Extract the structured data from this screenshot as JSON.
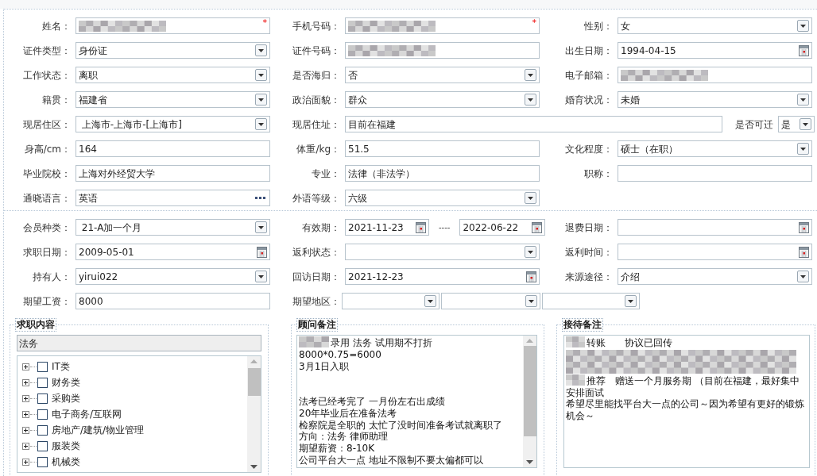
{
  "sections": [
    {
      "rows": [
        [
          {
            "label": "姓名：",
            "kind": "text",
            "redacted": true,
            "required_mark": "*"
          },
          {
            "label": "手机号码：",
            "kind": "text",
            "redacted": true,
            "required_mark": "*"
          },
          {
            "label": "性别：",
            "kind": "select",
            "value": "女"
          }
        ],
        [
          {
            "label": "证件类型：",
            "kind": "select",
            "value": "身份证"
          },
          {
            "label": "证件号码：",
            "kind": "text",
            "redacted": true
          },
          {
            "label": "出生日期：",
            "kind": "date",
            "value": "1994-04-15"
          }
        ],
        [
          {
            "label": "工作状态：",
            "kind": "select",
            "value": "离职"
          },
          {
            "label": "是否海归：",
            "kind": "select",
            "value": "否"
          },
          {
            "label": "电子邮箱：",
            "kind": "text",
            "redacted": true
          }
        ],
        [
          {
            "label": "籍贯：",
            "kind": "select",
            "value": "福建省"
          },
          {
            "label": "政治面貌：",
            "kind": "select",
            "value": "群众"
          },
          {
            "label": "婚育状况：",
            "kind": "select",
            "value": "未婚"
          }
        ],
        [
          {
            "label": "现居住区：",
            "kind": "select",
            "value": " 上海市-上海市-[上海市]"
          },
          {
            "label": "现居住址：",
            "kind": "address",
            "value": "目前在福建",
            "extra_label": "是否可迁",
            "extra_value": "是"
          }
        ],
        [
          {
            "label": "身高/cm：",
            "kind": "text",
            "value": "164"
          },
          {
            "label": "体重/kg：",
            "kind": "text",
            "value": "51.5"
          },
          {
            "label": "文化程度：",
            "kind": "select",
            "value": "硕士（在职）"
          }
        ],
        [
          {
            "label": "毕业院校：",
            "kind": "text",
            "value": "上海对外经贸大学"
          },
          {
            "label": "专业：",
            "kind": "text",
            "value": "法律（非法学）"
          },
          {
            "label": "职称：",
            "kind": "text"
          }
        ],
        [
          {
            "label": "通晓语言：",
            "kind": "lookup",
            "value": "英语"
          },
          {
            "label": "外语等级：",
            "kind": "select",
            "value": "六级"
          }
        ]
      ]
    },
    {
      "rows": [
        [
          {
            "label": "会员种类：",
            "kind": "select",
            "value": " 21-A加一个月"
          },
          {
            "label": "有效期：",
            "kind": "daterange",
            "value": "2021-11-23",
            "separator": "----",
            "end_value": "2022-06-22"
          },
          {
            "label": "退费日期：",
            "kind": "date"
          }
        ],
        [
          {
            "label": "求职日期：",
            "kind": "date",
            "value": "2009-05-01"
          },
          {
            "label": "返利状态：",
            "kind": "select"
          },
          {
            "label": "返利时间：",
            "kind": "date"
          }
        ],
        [
          {
            "label": "持有人：",
            "kind": "select",
            "value": "yirui022"
          },
          {
            "label": "回访日期：",
            "kind": "date",
            "value": "2021-12-23"
          },
          {
            "label": "来源途径：",
            "kind": "select",
            "value": "介绍"
          }
        ],
        [
          {
            "label": "期望工资：",
            "kind": "text",
            "value": "8000"
          },
          {
            "label": "期望地区：",
            "kind": "region",
            "selects": [
              {
                "kind": "select"
              },
              {
                "kind": "select"
              },
              {
                "kind": "select"
              }
            ]
          }
        ]
      ]
    }
  ],
  "job_content": {
    "title": "求职内容",
    "search_value": "法务",
    "tree": [
      {
        "label": "IT类",
        "expanded": false,
        "checked": false
      },
      {
        "label": "财务类",
        "expanded": false,
        "checked": false
      },
      {
        "label": "采购类",
        "expanded": false,
        "checked": false
      },
      {
        "label": "电子商务/互联网",
        "expanded": false,
        "checked": false
      },
      {
        "label": "房地产/建筑/物业管理",
        "expanded": false,
        "checked": false
      },
      {
        "label": "服装类",
        "expanded": false,
        "checked": false
      },
      {
        "label": "机械类",
        "expanded": false,
        "checked": false
      }
    ]
  },
  "advisor_notes": {
    "title": "顾问备注",
    "lines": [
      {
        "kind": "text",
        "text": "录用 法务 试用期不打折",
        "redacted_prefix": true
      },
      {
        "kind": "text",
        "text": "8000*0.75=6000"
      },
      {
        "kind": "text",
        "text": "3月1日入职"
      },
      {
        "kind": "blank"
      },
      {
        "kind": "blank"
      },
      {
        "kind": "text",
        "text": "法考已经考完了 一月份左右出成绩"
      },
      {
        "kind": "text",
        "text": "20年毕业后在准备法考"
      },
      {
        "kind": "text",
        "text": "检察院是全职的 太忙了没时间准备考试就离职了"
      },
      {
        "kind": "text",
        "text": "方向：法务 律师助理"
      },
      {
        "kind": "text",
        "text": "期望薪资：8-10K"
      },
      {
        "kind": "text",
        "text": "公司平台大一点 地址不限制不要太偏都可以"
      }
    ]
  },
  "reception_notes": {
    "title": "接待备注",
    "lines": [
      {
        "kind": "text",
        "text": "转账　　协议已回传",
        "redacted_prefix": true
      },
      {
        "kind": "redacted"
      },
      {
        "kind": "text",
        "text": "推荐　赠送一个月服务期 （目前在福建，最好集中安排面试",
        "redacted_prefix": true
      },
      {
        "kind": "text",
        "text": "希望尽里能找平台大一点的公司～因为希望有更好的锻炼机会～"
      }
    ]
  }
}
